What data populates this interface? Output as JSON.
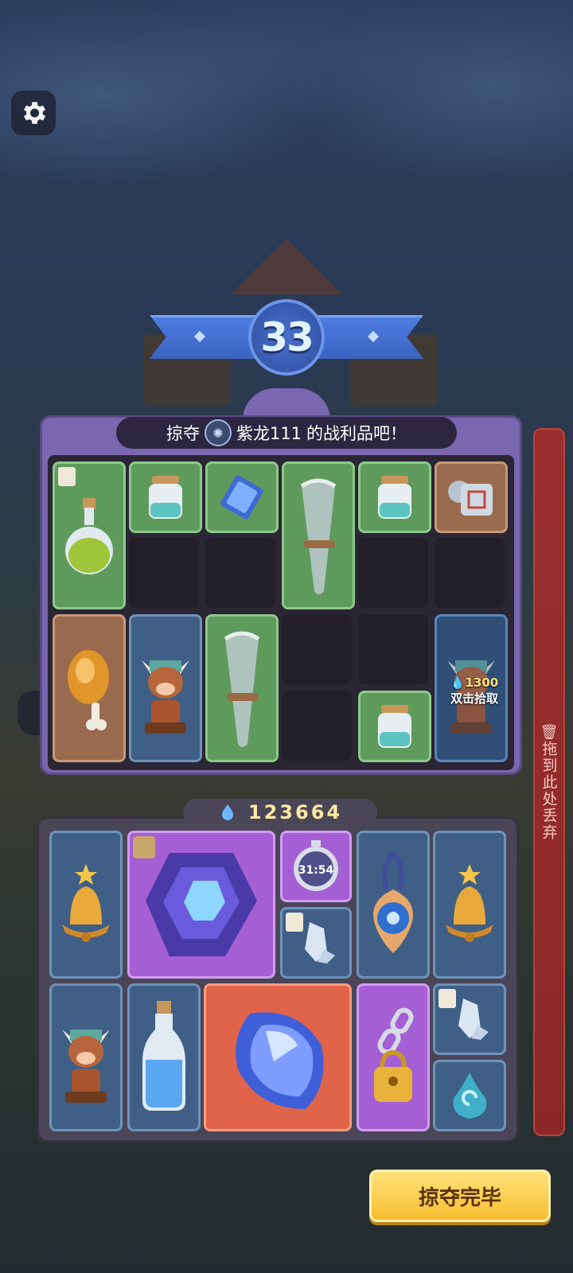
{
  "round": {
    "number": "33"
  },
  "loot": {
    "title_prefix": "掠夺",
    "opponent_name": "紫龙111",
    "title_suffix": "的战利品吧！",
    "price_value": "1300",
    "pickup_hint": "双击拾取"
  },
  "currency": {
    "gems": "123664"
  },
  "discard": {
    "label": "拖到此处丢弃"
  },
  "actions": {
    "finish_label": "掠夺完毕"
  },
  "timer_item": {
    "time": "31:54"
  },
  "colors": {
    "loot_panel": "#7b66b0",
    "green_slot": "#5f9a5d",
    "blue_slot": "#3f5f86",
    "purple_slot": "#a45fd4",
    "red_slot": "#e0644a",
    "finish_button": "#f7bd2f",
    "discard_strip": "#9b2f2e"
  },
  "loot_items": [
    "green-potion",
    "empty-jar",
    "blue-card",
    "stone-horn",
    "empty-jar",
    "stone-block",
    "roast-drumstick",
    "bull-totem",
    "stone-horn",
    "empty-jar",
    "bull-totem"
  ],
  "inventory_items": [
    "golden-bell",
    "purple-gem",
    "stopwatch",
    "white-crystal",
    "blue-amulet",
    "golden-bell",
    "bull-totem",
    "blue-potion",
    "blue-crystal",
    "padlock-chain",
    "white-crystal",
    "water-drop"
  ]
}
